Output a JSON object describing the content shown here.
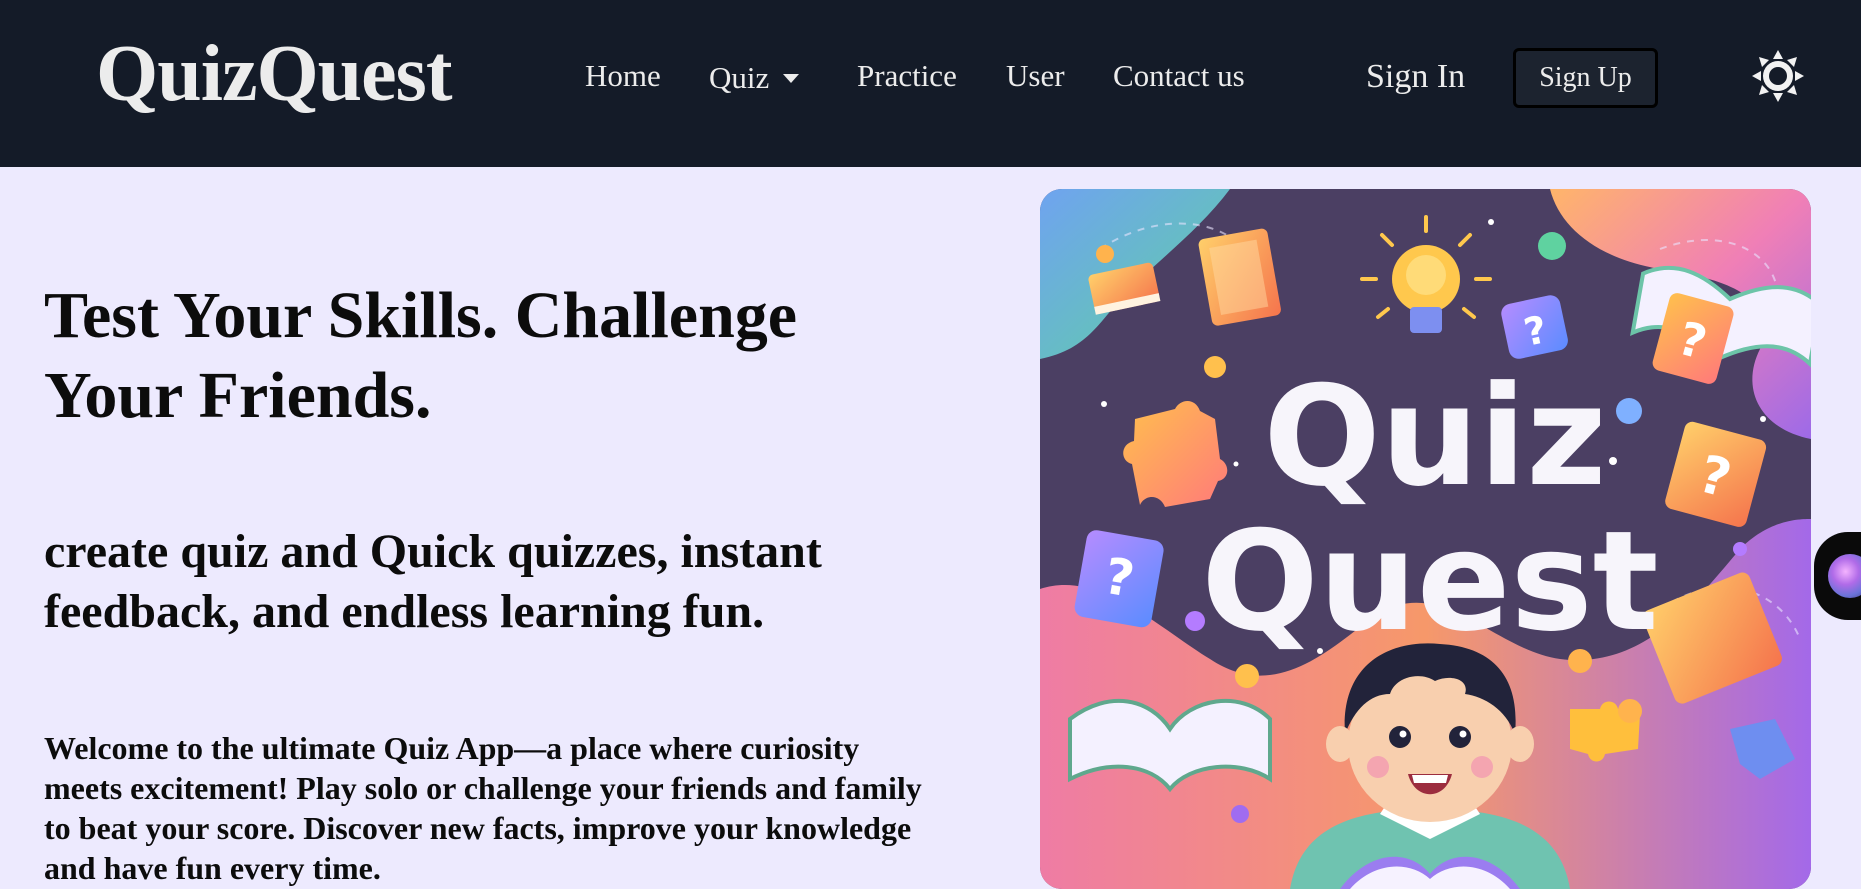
{
  "header": {
    "brand": "QuizQuest",
    "nav": [
      {
        "label": "Home"
      },
      {
        "label": "Quiz"
      },
      {
        "label": "Practice"
      },
      {
        "label": "User"
      },
      {
        "label": "Contact us"
      }
    ],
    "sign_in": "Sign In",
    "sign_up": "Sign Up",
    "theme_icon": "sun-icon"
  },
  "hero": {
    "title": "Test Your Skills. Challenge Your Friends.",
    "subtitle": "create quiz and Quick quizzes, instant feedback, and endless learning fun.",
    "body": "Welcome to the ultimate Quiz App—a place where curiosity meets excitement! Play solo or challenge your friends and family to beat your score. Discover new facts, improve your knowledge and have fun every time."
  },
  "poster": {
    "title_line1": "Quiz",
    "title_line2": "Quest"
  },
  "colors": {
    "header_bg": "#141b28",
    "page_bg": "#edeafe",
    "poster_bg": "#4b3f63"
  }
}
